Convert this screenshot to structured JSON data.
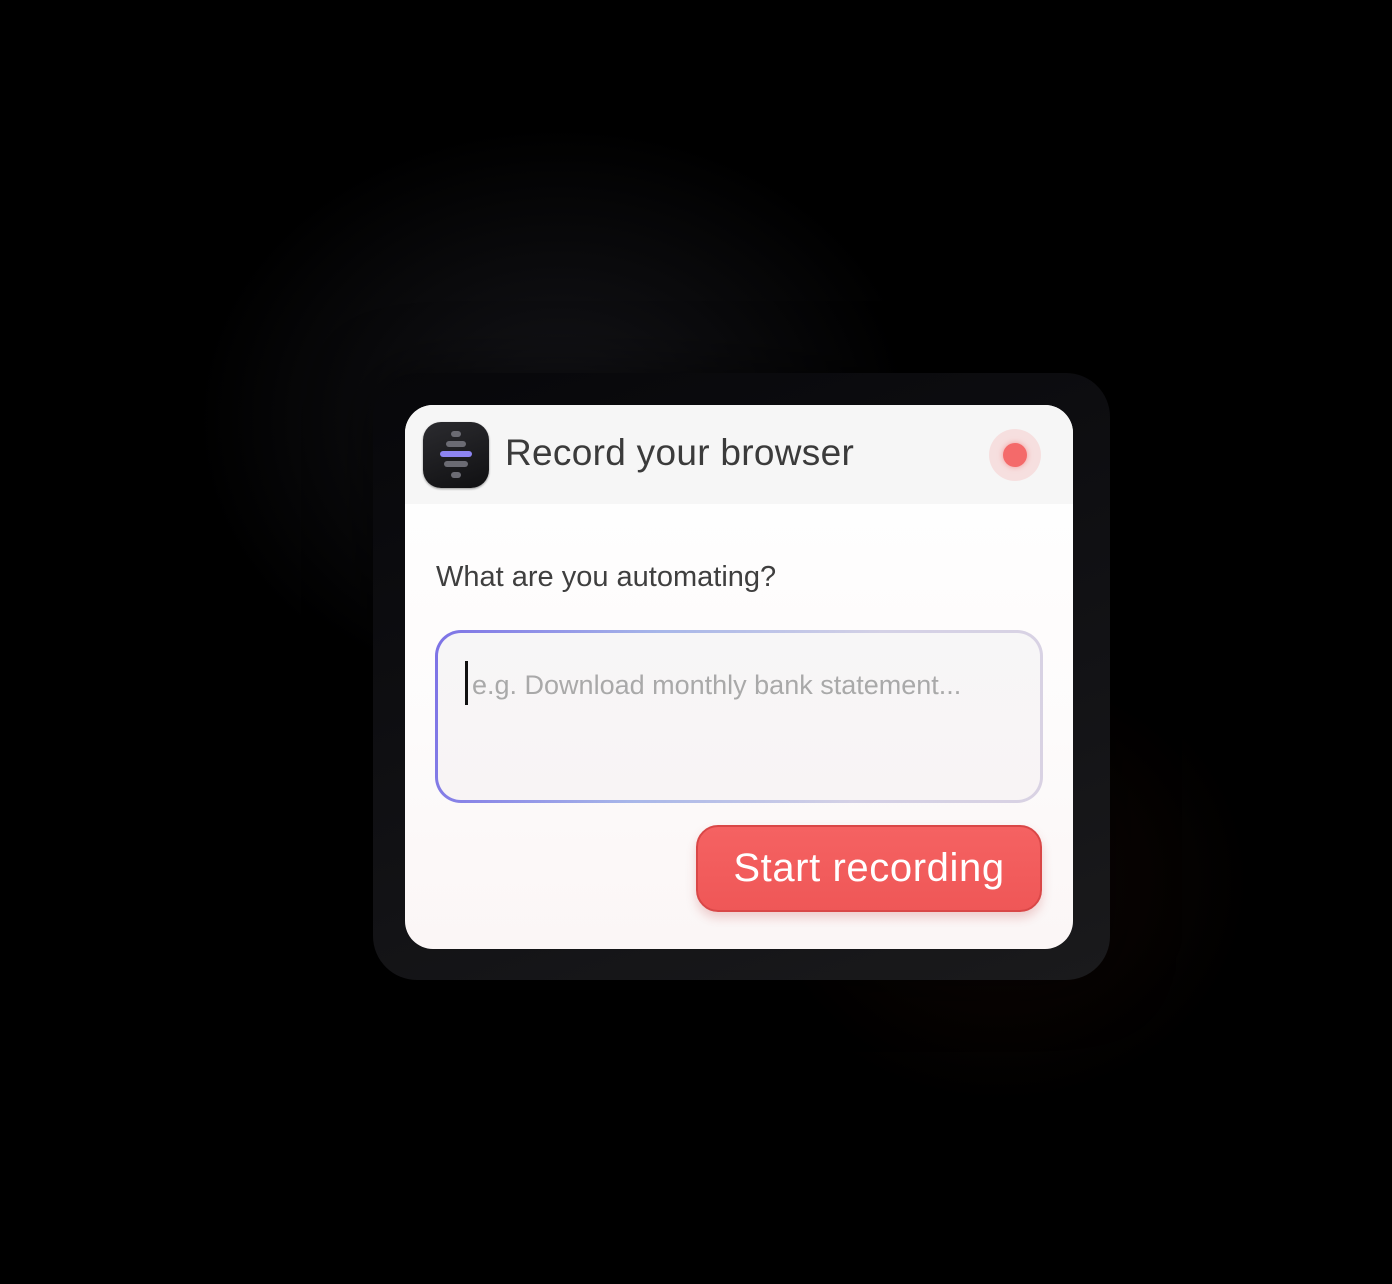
{
  "dialog": {
    "title": "Record your browser",
    "app_icon": "bars-logo-icon",
    "record_indicator_icon": "record-dot-icon",
    "record_indicator_color": "#f46a6a"
  },
  "form": {
    "question": "What are you automating?",
    "task_input": {
      "value": "",
      "placeholder": "e.g. Download monthly bank statement..."
    },
    "start_button_label": "Start recording",
    "start_button_color": "#f25a5a"
  }
}
